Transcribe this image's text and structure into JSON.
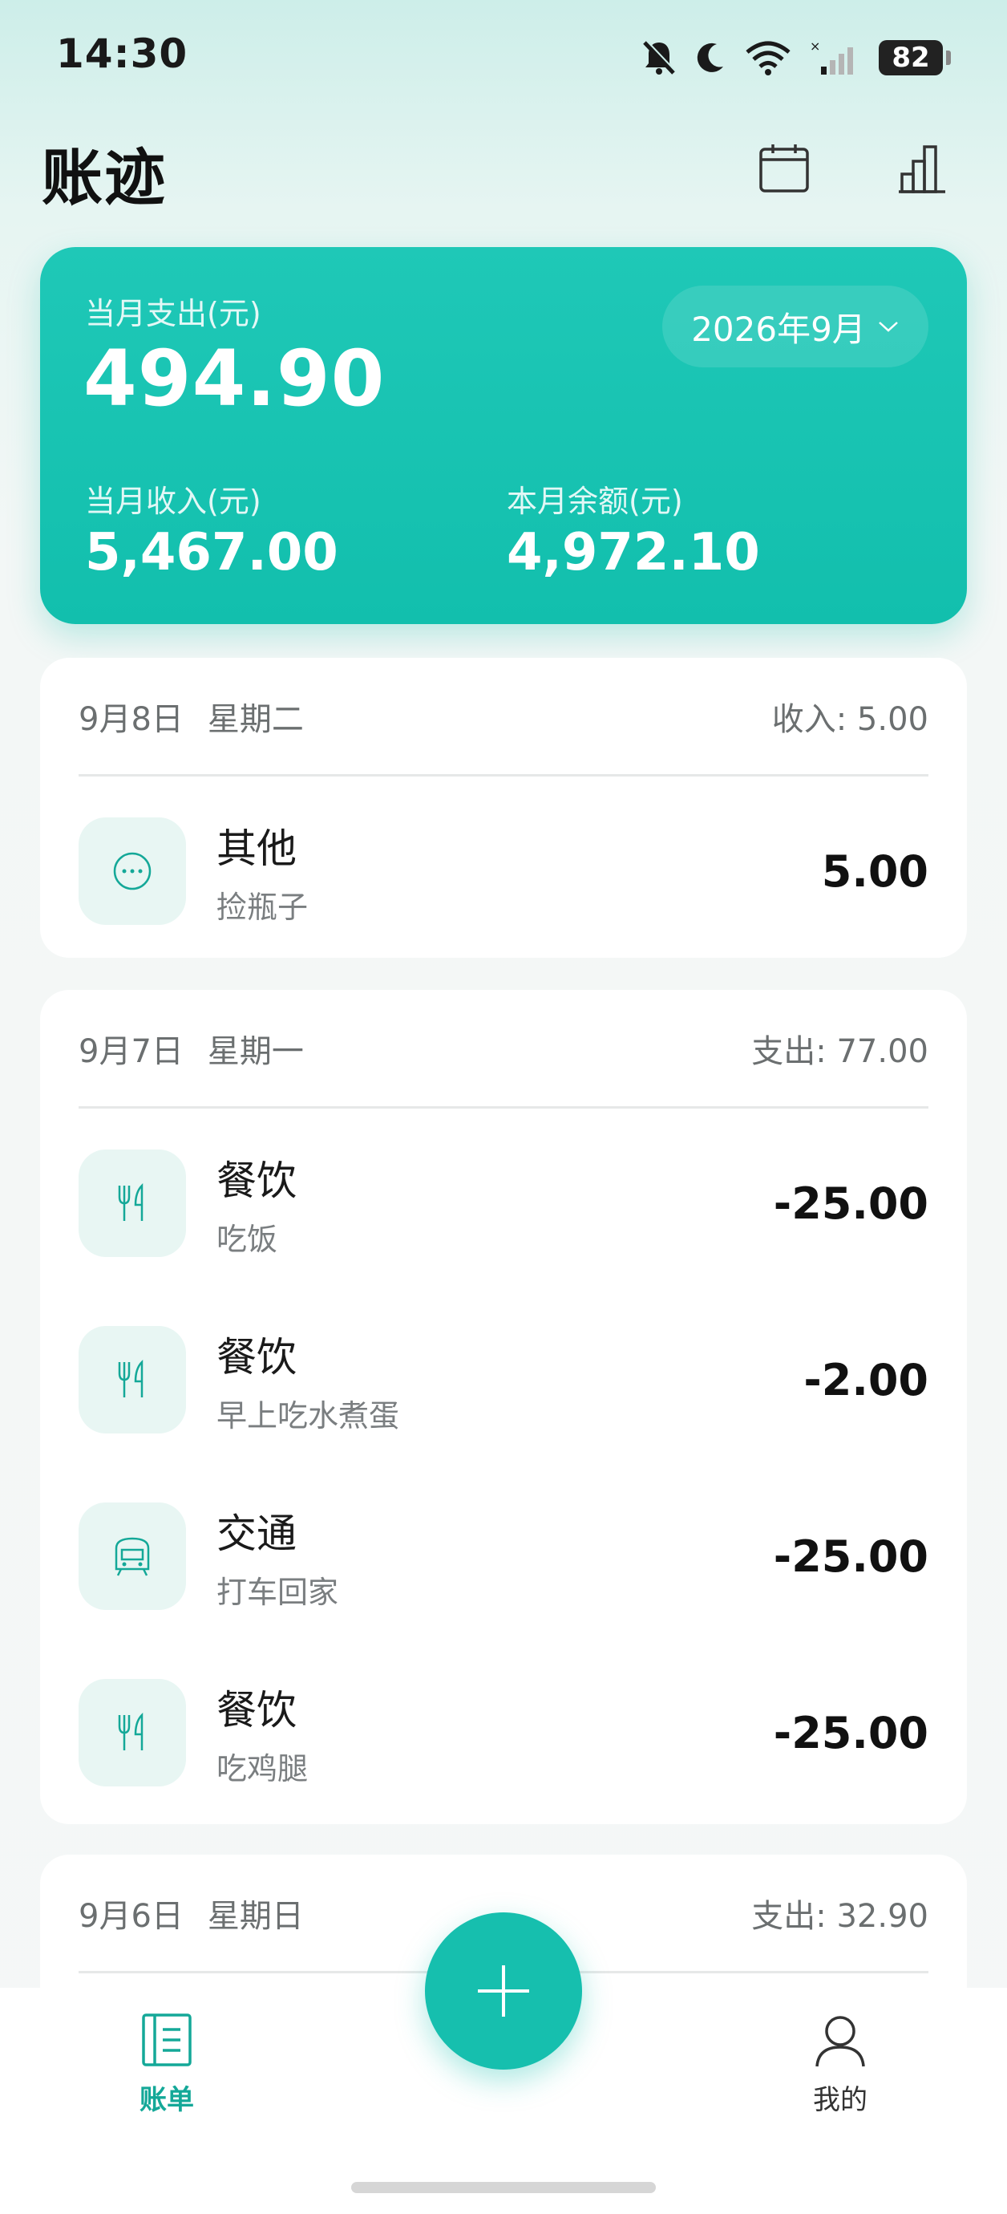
{
  "status_bar": {
    "time": "14:30",
    "battery": "82"
  },
  "header": {
    "title": "账迹"
  },
  "summary": {
    "expense_label": "当月支出(元)",
    "expense_value": "494.90",
    "month_picker": "2026年9月",
    "income_label": "当月收入(元)",
    "income_value": "5,467.00",
    "balance_label": "本月余额(元)",
    "balance_value": "4,972.10"
  },
  "days": [
    {
      "date": "9月8日",
      "weekday": "星期二",
      "total": "收入: 5.00",
      "entries": [
        {
          "icon": "more-dots-icon",
          "category": "其他",
          "note": "捡瓶子",
          "amount": "5.00"
        }
      ]
    },
    {
      "date": "9月7日",
      "weekday": "星期一",
      "total": "支出: 77.00",
      "entries": [
        {
          "icon": "fork-knife-icon",
          "category": "餐饮",
          "note": "吃饭",
          "amount": "-25.00"
        },
        {
          "icon": "fork-knife-icon",
          "category": "餐饮",
          "note": "早上吃水煮蛋",
          "amount": "-2.00"
        },
        {
          "icon": "bus-icon",
          "category": "交通",
          "note": "打车回家",
          "amount": "-25.00"
        },
        {
          "icon": "fork-knife-icon",
          "category": "餐饮",
          "note": "吃鸡腿",
          "amount": "-25.00"
        }
      ]
    },
    {
      "date": "9月6日",
      "weekday": "星期日",
      "total": "支出: 32.90",
      "entries": []
    }
  ],
  "bottom_nav": {
    "bills_label": "账单",
    "me_label": "我的"
  },
  "colors": {
    "accent": "#16bfae",
    "accent_dark": "#14a898",
    "icon_bg": "#e8f6f3"
  }
}
